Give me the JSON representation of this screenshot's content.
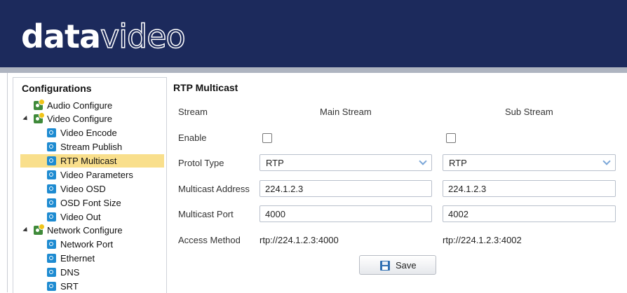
{
  "brand": {
    "logo_bold": "data",
    "logo_light": "video"
  },
  "sidebar": {
    "title": "Configurations",
    "items": [
      {
        "label": "Audio Configure",
        "icon": "gear-group-icon"
      },
      {
        "label": "Video Configure",
        "icon": "gear-group-icon"
      },
      {
        "label": "Video Encode",
        "icon": "gear-icon"
      },
      {
        "label": "Stream Publish",
        "icon": "gear-icon"
      },
      {
        "label": "RTP Multicast",
        "icon": "gear-icon",
        "selected": true
      },
      {
        "label": "Video Parameters",
        "icon": "gear-icon"
      },
      {
        "label": "Video OSD",
        "icon": "gear-icon"
      },
      {
        "label": "OSD Font Size",
        "icon": "gear-icon"
      },
      {
        "label": "Video Out",
        "icon": "gear-icon"
      },
      {
        "label": "Network Configure",
        "icon": "gear-group-icon"
      },
      {
        "label": "Network Port",
        "icon": "gear-icon"
      },
      {
        "label": "Ethernet",
        "icon": "gear-icon"
      },
      {
        "label": "DNS",
        "icon": "gear-icon"
      },
      {
        "label": "SRT",
        "icon": "gear-icon"
      }
    ]
  },
  "main": {
    "title": "RTP Multicast",
    "labels": {
      "stream": "Stream",
      "enable": "Enable",
      "protocol": "Protol Type",
      "address": "Multicast Address",
      "port": "Multicast Port",
      "access": "Access Method"
    },
    "main_stream": {
      "header": "Main Stream",
      "enabled": false,
      "protocol": "RTP",
      "address": "224.1.2.3",
      "port": "4000",
      "access": "rtp://224.1.2.3:4000"
    },
    "sub_stream": {
      "header": "Sub Stream",
      "enabled": false,
      "protocol": "RTP",
      "address": "224.1.2.3",
      "port": "4002",
      "access": "rtp://224.1.2.3:4002"
    },
    "save_label": "Save"
  },
  "colors": {
    "header_bg": "#1c2a5c",
    "selected_bg": "#f9df8c",
    "leaf_icon": "#1e8bd1",
    "group_icon": "#3f8a3a"
  }
}
